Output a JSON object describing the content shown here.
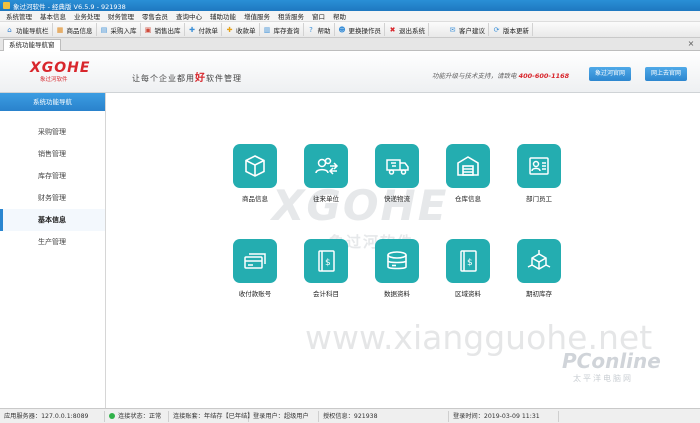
{
  "window": {
    "title": "象过河软件 - 经典版 V6.5.9 - 921938"
  },
  "menu": [
    "系统管理",
    "基本信息",
    "业务处理",
    "财务管理",
    "零售会员",
    "查询中心",
    "辅助功能",
    "增值服务",
    "租赁服务",
    "窗口",
    "帮助"
  ],
  "toolbar": [
    {
      "label": "功能导航栏",
      "icon": "home-icon",
      "glyph": "⌂",
      "color": "#2f7fd0"
    },
    {
      "label": "商品信息",
      "icon": "product-icon",
      "glyph": "▦",
      "color": "#e08a1e"
    },
    {
      "label": "采购入库",
      "icon": "purchase-icon",
      "glyph": "▤",
      "color": "#3a8fd8"
    },
    {
      "label": "销售出库",
      "icon": "sales-icon",
      "glyph": "▣",
      "color": "#d04a3a"
    },
    {
      "label": "付款单",
      "icon": "payment-icon",
      "glyph": "✚",
      "color": "#3a8fd8"
    },
    {
      "label": "收款单",
      "icon": "receipt-icon",
      "glyph": "✚",
      "color": "#e6a21a"
    },
    {
      "label": "库存查询",
      "icon": "inventory-icon",
      "glyph": "▥",
      "color": "#3a8fd8"
    },
    {
      "label": "帮助",
      "icon": "help-icon",
      "glyph": "?",
      "color": "#3a8fd8"
    },
    {
      "label": "更换操作员",
      "icon": "switch-user-icon",
      "glyph": "☻",
      "color": "#3a8fd8"
    },
    {
      "label": "退出系统",
      "icon": "exit-icon",
      "glyph": "✖",
      "color": "#d8262c"
    },
    {
      "label": "客户建议",
      "icon": "feedback-icon",
      "glyph": "✉",
      "color": "#3a8fd8"
    },
    {
      "label": "版本更新",
      "icon": "update-icon",
      "glyph": "⟳",
      "color": "#3a8fd8"
    }
  ],
  "tabs": {
    "active": "系统功能导航窗",
    "close": "×"
  },
  "banner": {
    "brand": "XGOHE",
    "brand_sub": "象过河软件",
    "slogan_a": "让每个企业都用",
    "slogan_b": "好",
    "slogan_c": "软件管理",
    "support_text": "功能升级与技术支持，请致电",
    "phone": "400-600-1168",
    "btn_official": "象过河官网",
    "btn_online": "网上去官网"
  },
  "sidebar": {
    "header": "系统功能导航",
    "items": [
      "采购管理",
      "销售管理",
      "库存管理",
      "财务管理",
      "基本信息",
      "生产管理"
    ],
    "active_index": 4
  },
  "tiles": [
    "商品信息",
    "往来单位",
    "快递物流",
    "仓库信息",
    "部门员工",
    "收付款账号",
    "会计科目",
    "数据资料",
    "区域资料",
    "期初库存"
  ],
  "watermark": {
    "logo": "XGOHE",
    "cn": "象过河软件",
    "url": "www.xiangguohe.net",
    "pc": "PConline",
    "pc_sub": "太平洋电脑网"
  },
  "status": {
    "server": "应用服务器：127.0.0.1:8089",
    "conn": "连接状态：正常",
    "account": "连接账套：年结存【已年结】",
    "user": "登录用户：超级用户",
    "license": "授权信息：921938",
    "login_time": "登录时间：2019-03-09 11:31"
  },
  "colors": {
    "accent": "#2a86d0",
    "tile": "#24adb0",
    "brand": "#d8262c"
  }
}
